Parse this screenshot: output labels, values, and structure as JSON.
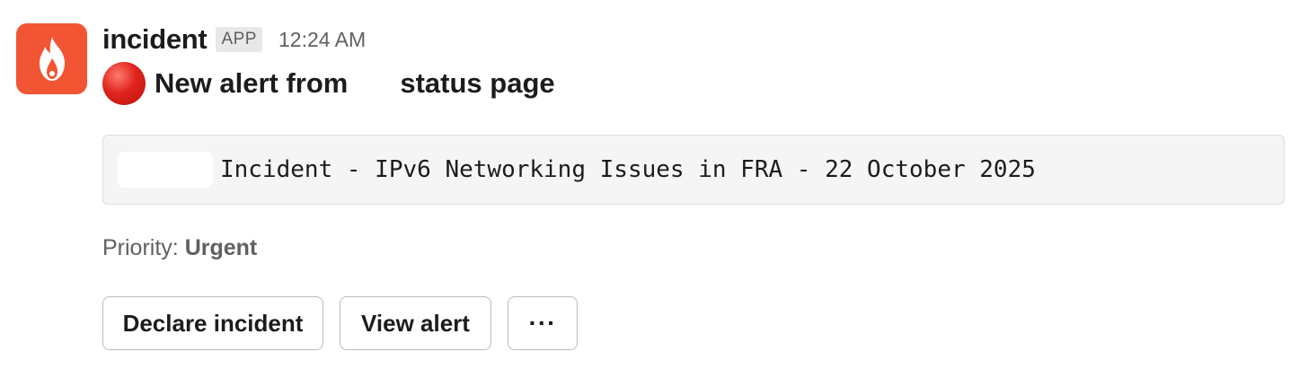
{
  "message": {
    "sender": "incident",
    "badge": "APP",
    "timestamp": "12:24 AM",
    "avatar_icon": "flame-icon",
    "avatar_color": "#f25533"
  },
  "headline": {
    "status_icon": "red-circle-icon",
    "text_before": "New alert from",
    "text_after": "status page"
  },
  "alert": {
    "title": "Incident - IPv6 Networking Issues in FRA - 22 October 2025"
  },
  "priority": {
    "label": "Priority:",
    "value": "Urgent"
  },
  "actions": {
    "declare_label": "Declare incident",
    "view_label": "View alert",
    "more_label": "···"
  }
}
